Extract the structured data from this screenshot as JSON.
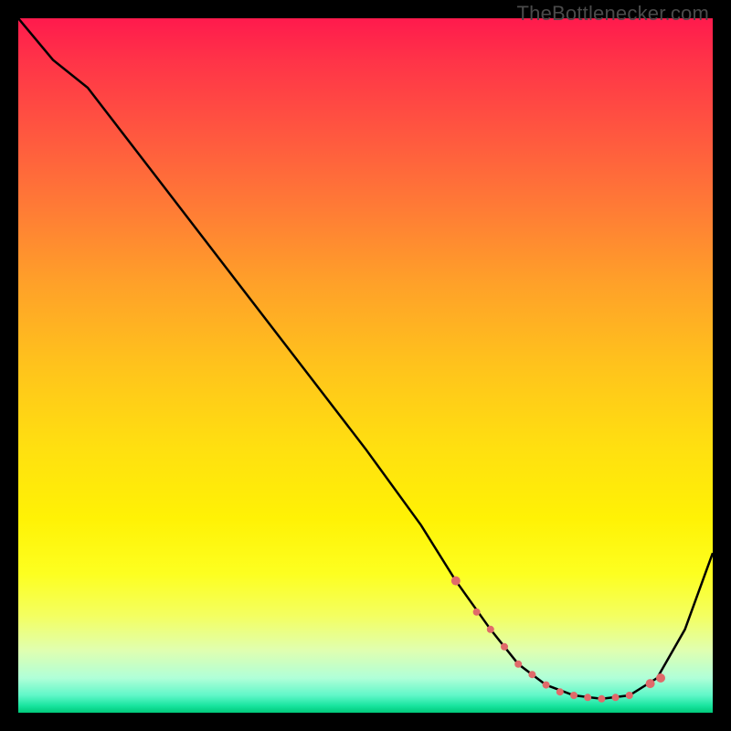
{
  "watermark": "TheBottlenecker.com",
  "chart_data": {
    "type": "line",
    "title": "",
    "xlabel": "",
    "ylabel": "",
    "xlim": [
      0,
      100
    ],
    "ylim": [
      0,
      100
    ],
    "series": [
      {
        "name": "curve",
        "x": [
          0,
          5,
          10,
          20,
          30,
          40,
          50,
          58,
          63,
          68,
          72,
          76,
          80,
          84,
          88,
          92,
          96,
          100
        ],
        "y": [
          100,
          94,
          90,
          77,
          64,
          51,
          38,
          27,
          19,
          12,
          7,
          4,
          2.5,
          2,
          2.5,
          5,
          12,
          23
        ]
      }
    ],
    "markers": {
      "name": "highlight-dots",
      "color": "#e06a6a",
      "x": [
        63,
        66,
        68,
        70,
        72,
        74,
        76,
        78,
        80,
        82,
        84,
        86,
        88,
        91,
        92.5
      ],
      "y": [
        19,
        14.5,
        12,
        9.5,
        7,
        5.5,
        4,
        3,
        2.5,
        2.2,
        2,
        2.2,
        2.5,
        4.2,
        5
      ]
    }
  }
}
